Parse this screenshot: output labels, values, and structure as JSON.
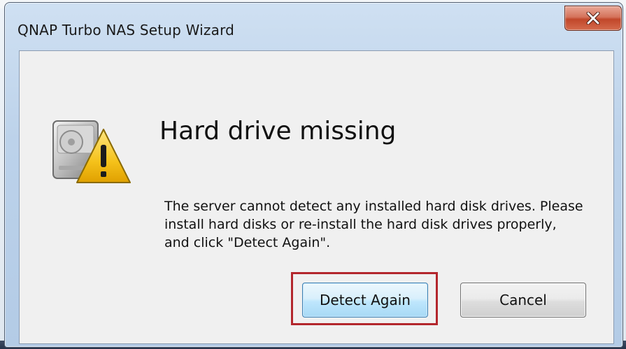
{
  "window": {
    "title": "QNAP Turbo NAS Setup Wizard",
    "close_icon": "close-icon"
  },
  "dialog": {
    "icon": "hard-drive-warning-icon",
    "heading": "Hard drive missing",
    "message": "The server cannot detect any installed hard disk drives. Please install hard disks or re-install the hard disk drives properly, and click \"Detect Again\".",
    "highlight_color": "#b3262c"
  },
  "buttons": {
    "detect_again": "Detect Again",
    "cancel": "Cancel"
  }
}
